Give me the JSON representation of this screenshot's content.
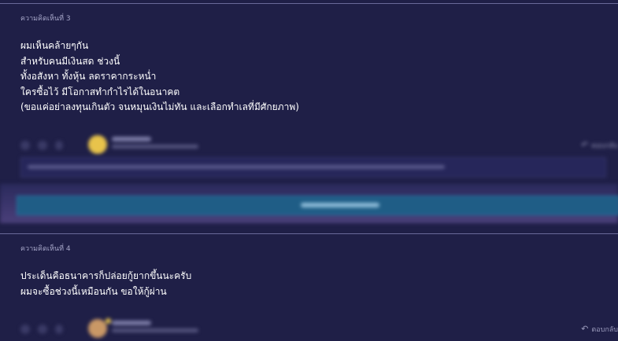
{
  "comments": [
    {
      "number_label": "ความคิดเห็นที่ 3",
      "lines": [
        "ผมเห็นคล้ายๆกัน",
        "สำหรับคนมีเงินสด ช่วงนี้",
        "ทั้งอสังหา ทั้งหุ้น ลดราคากระหน่ำ",
        "ใครซื้อไว้ มีโอกาสทำกำไรได้ในอนาคต",
        "(ขอแค่อย่าลงทุนเกินตัว จนหมุนเงินไม่ทัน และเลือกทำเลที่มีศักยภาพ)"
      ],
      "reply_label": "ตอบกลับ"
    },
    {
      "number_label": "ความคิดเห็นที่ 4",
      "lines": [
        "ประเด็นคือธนาคารก็ปล่อยกู้ยากขึ้นนะครับ",
        "ผมจะซื้อช่วงนี้เหมือนกัน ขอให้กู้ผ่าน"
      ],
      "reply_label": "ตอบกลับ"
    }
  ],
  "icons": {
    "reply": "reply-arrow-icon",
    "emoticon": "emoticon-icon",
    "quote": "quote-icon"
  },
  "colors": {
    "background": "#1f1f47",
    "submit_button": "#1f5d86",
    "secondary_text": "#a6a6c8"
  }
}
